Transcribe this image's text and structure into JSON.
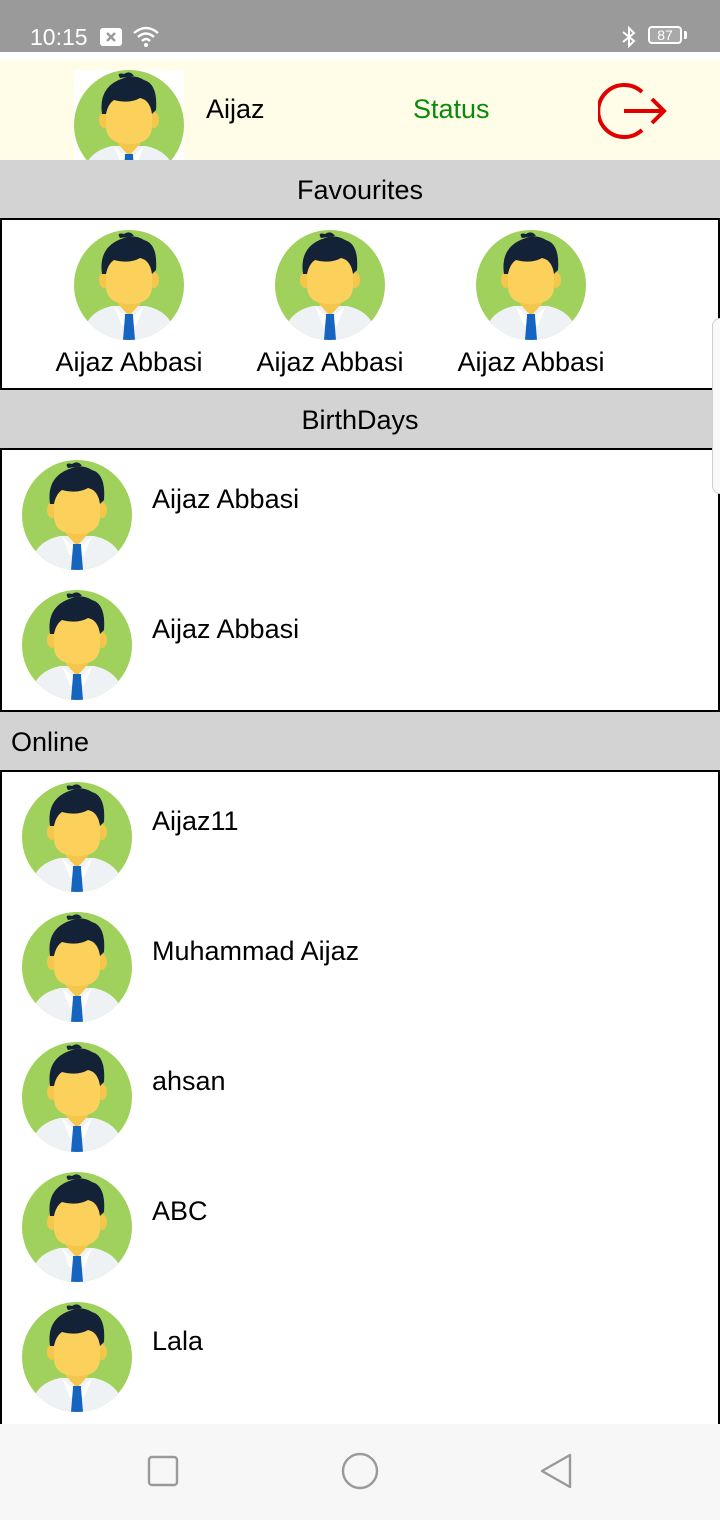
{
  "status_bar": {
    "time": "10:15",
    "battery": "87",
    "icons": [
      "notification-x-icon",
      "wifi-icon",
      "bluetooth-icon",
      "battery-icon"
    ]
  },
  "header": {
    "user_name": "Aijaz",
    "status_label": "Status",
    "status_color": "#0a8a0a",
    "logout_icon": "logout-icon",
    "logout_color": "#e00000",
    "background": "#fffde8"
  },
  "favourites": {
    "title": "Favourites",
    "items": [
      {
        "name": "Aijaz Abbasi"
      },
      {
        "name": "Aijaz Abbasi"
      },
      {
        "name": "Aijaz Abbasi"
      }
    ]
  },
  "birthdays": {
    "title": "BirthDays",
    "items": [
      {
        "name": "Aijaz Abbasi"
      },
      {
        "name": "Aijaz Abbasi"
      }
    ]
  },
  "online": {
    "title": "Online",
    "items": [
      {
        "name": "Aijaz11"
      },
      {
        "name": "Muhammad Aijaz"
      },
      {
        "name": "ahsan"
      },
      {
        "name": "ABC"
      },
      {
        "name": "Lala"
      }
    ]
  },
  "nav_bar": {
    "buttons": [
      "recents-square-icon",
      "home-circle-icon",
      "back-triangle-icon"
    ]
  },
  "colors": {
    "section_bg": "#d3d3d3",
    "avatar_bg": "#9fd15c",
    "tie": "#1565c0"
  }
}
